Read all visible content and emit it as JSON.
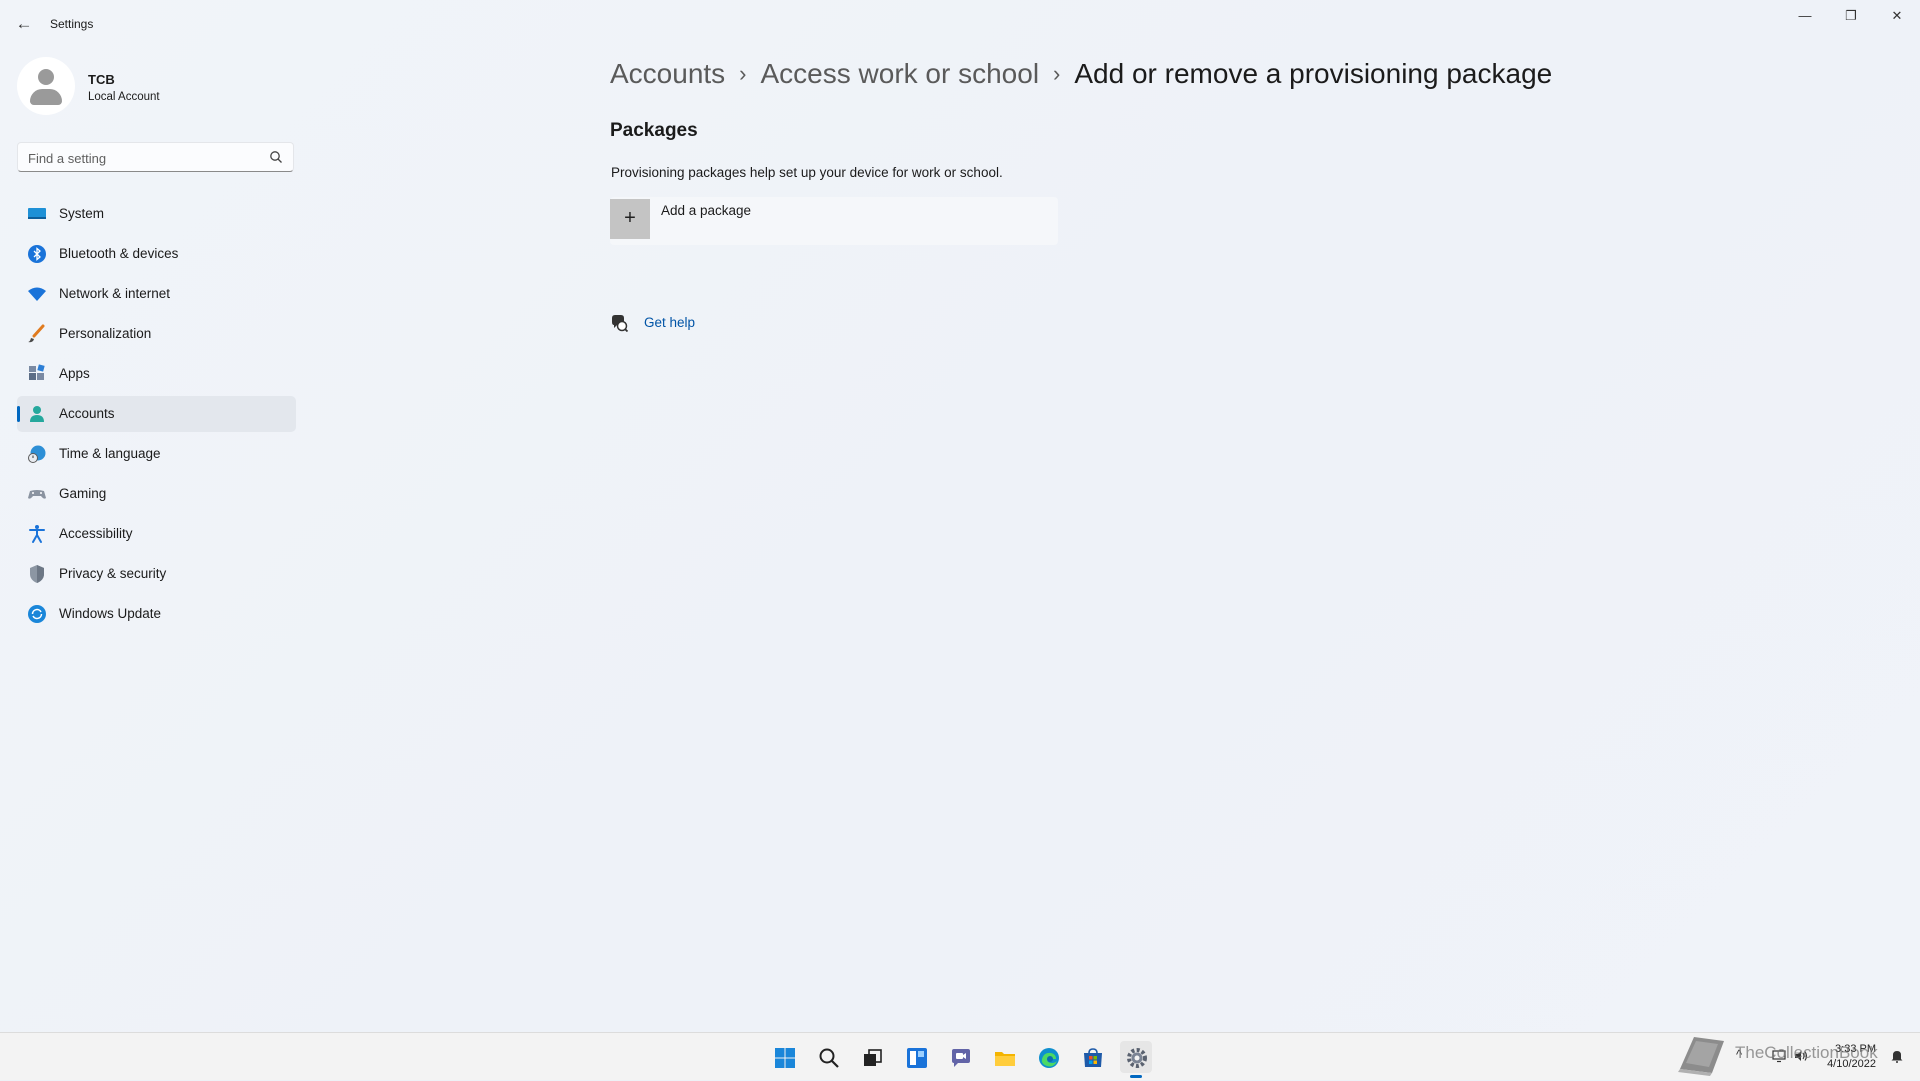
{
  "window": {
    "title": "Settings",
    "back_glyph": "←",
    "minimize_glyph": "—",
    "maximize_glyph": "❐",
    "close_glyph": "✕"
  },
  "profile": {
    "name": "TCB",
    "account_type": "Local Account"
  },
  "search": {
    "placeholder": "Find a setting"
  },
  "sidebar": {
    "items": [
      {
        "label": "System",
        "icon": "system-icon"
      },
      {
        "label": "Bluetooth & devices",
        "icon": "bluetooth-icon"
      },
      {
        "label": "Network & internet",
        "icon": "wifi-icon"
      },
      {
        "label": "Personalization",
        "icon": "brush-icon"
      },
      {
        "label": "Apps",
        "icon": "apps-icon"
      },
      {
        "label": "Accounts",
        "icon": "accounts-icon",
        "selected": true
      },
      {
        "label": "Time & language",
        "icon": "globe-clock-icon"
      },
      {
        "label": "Gaming",
        "icon": "gamepad-icon"
      },
      {
        "label": "Accessibility",
        "icon": "accessibility-icon"
      },
      {
        "label": "Privacy & security",
        "icon": "shield-icon"
      },
      {
        "label": "Windows Update",
        "icon": "update-icon"
      }
    ]
  },
  "breadcrumb": {
    "items": [
      "Accounts",
      "Access work or school"
    ],
    "separator": "›",
    "current": "Add or remove a provisioning package"
  },
  "packages": {
    "title": "Packages",
    "description": "Provisioning packages help set up your device for work or school.",
    "add_label": "Add a package",
    "add_glyph": "+"
  },
  "help": {
    "label": "Get help"
  },
  "taskbar": {
    "apps": [
      "start-icon",
      "search-icon",
      "task-view-icon",
      "widgets-icon",
      "chat-icon",
      "file-explorer-icon",
      "edge-icon",
      "store-icon",
      "settings-icon"
    ],
    "tray": {
      "chevron": "^",
      "time": "3:33 PM",
      "date": "4/10/2022"
    },
    "watermark_text": "TheCollectionBook"
  },
  "colors": {
    "accent": "#0067c0",
    "link": "#0054a6",
    "selected_bg": "#e3e7ed"
  }
}
